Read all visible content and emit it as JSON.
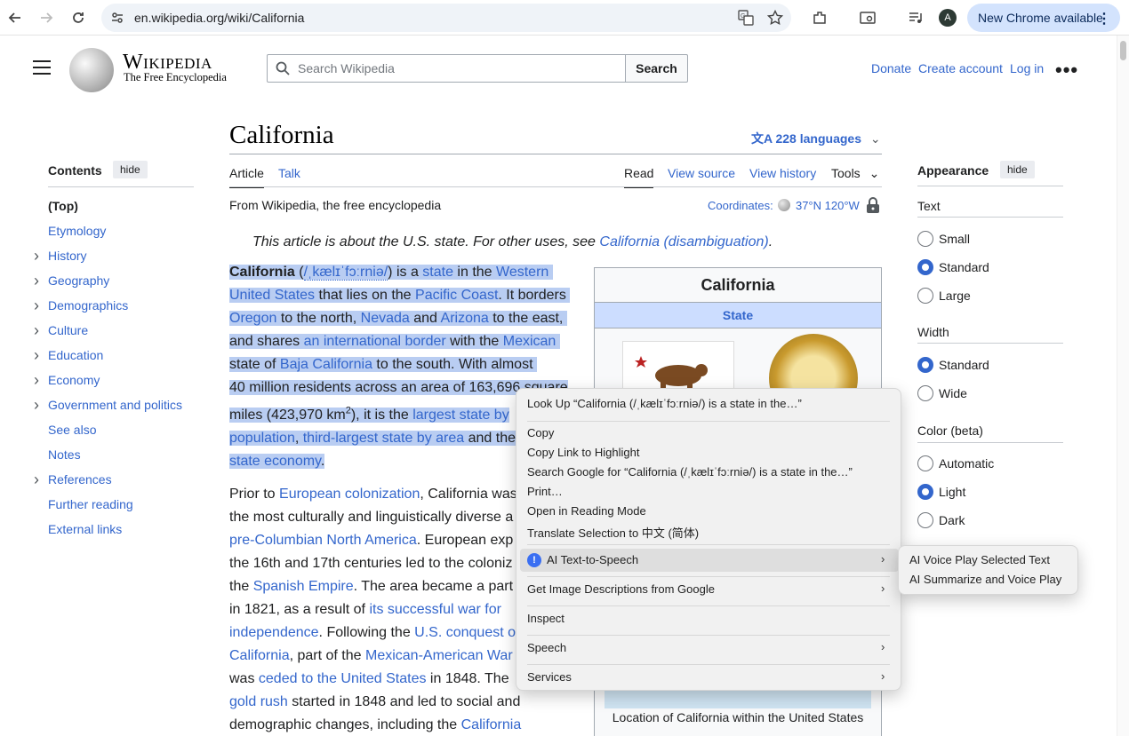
{
  "browser": {
    "url": "en.wikipedia.org/wiki/California",
    "update_label": "New Chrome available",
    "profile_initial": "A"
  },
  "header": {
    "wordmark": "Wikipedia",
    "tagline": "The Free Encyclopedia",
    "search_placeholder": "Search Wikipedia",
    "search_button": "Search",
    "donate": "Donate",
    "create_account": "Create account",
    "log_in": "Log in"
  },
  "toc": {
    "title": "Contents",
    "hide": "hide",
    "items": [
      {
        "label": "(Top)",
        "expandable": false,
        "active": true
      },
      {
        "label": "Etymology",
        "expandable": false
      },
      {
        "label": "History",
        "expandable": true
      },
      {
        "label": "Geography",
        "expandable": true
      },
      {
        "label": "Demographics",
        "expandable": true
      },
      {
        "label": "Culture",
        "expandable": true
      },
      {
        "label": "Education",
        "expandable": true
      },
      {
        "label": "Economy",
        "expandable": true
      },
      {
        "label": "Government and politics",
        "expandable": true
      },
      {
        "label": "See also",
        "expandable": false
      },
      {
        "label": "Notes",
        "expandable": false
      },
      {
        "label": "References",
        "expandable": true
      },
      {
        "label": "Further reading",
        "expandable": false
      },
      {
        "label": "External links",
        "expandable": false
      }
    ]
  },
  "article": {
    "title": "California",
    "languages": "228 languages",
    "tabs": {
      "article": "Article",
      "talk": "Talk",
      "read": "Read",
      "view_source": "View source",
      "view_history": "View history",
      "tools": "Tools"
    },
    "from": "From Wikipedia, the free encyclopedia",
    "coords_label": "Coordinates:",
    "coords_value": "37°N 120°W",
    "hatnote_text": "This article is about the U.S. state. For other uses, see ",
    "hatnote_link": "California (disambiguation)",
    "p1": {
      "l1": [
        "California",
        " (",
        "/ˌkælɪˈfɔːrniə/",
        ") is a ",
        "state",
        " in the ",
        "Western"
      ],
      "l2": [
        "United States",
        " that lies on the ",
        "Pacific Coast",
        ". It borders"
      ],
      "l3": [
        "Oregon",
        " to the north, ",
        "Nevada",
        " and ",
        "Arizona",
        " to the east,"
      ],
      "l4": [
        "and shares ",
        "an international border",
        " with the ",
        "Mexican"
      ],
      "l5": [
        "state of ",
        "Baja California",
        " to the south. With almost"
      ],
      "l6": [
        "40 million residents across an area of 163,696 square"
      ],
      "l7": [
        "miles (423,970 km",
        "2",
        "), it is the ",
        "largest state by"
      ],
      "l8": [
        "population",
        ", ",
        "third-largest state by area",
        " and the"
      ],
      "l9": [
        "state economy",
        "."
      ]
    },
    "p2": {
      "l1": [
        "Prior to ",
        "European colonization",
        ", California was"
      ],
      "l2": [
        "the most culturally and linguistically diverse a"
      ],
      "l3": [
        "pre-Columbian North America",
        ". European exp"
      ],
      "l4": [
        "the 16th and 17th centuries led to the coloniz"
      ],
      "l5": [
        "the ",
        "Spanish Empire",
        ". The area became a part"
      ],
      "l6": [
        "in 1821, as a result of ",
        "its successful war for"
      ],
      "l7": [
        "independence",
        ". Following the ",
        "U.S. conquest o"
      ],
      "l8": [
        "California",
        ", part of the ",
        "Mexican-American War"
      ],
      "l9": [
        "was ",
        "ceded to the United States",
        " in 1848. The "
      ],
      "l10": [
        "gold rush",
        " started in 1848 and led to social and"
      ],
      "l11": [
        "demographic changes, including the ",
        "California"
      ]
    }
  },
  "infobox": {
    "title": "California",
    "subtitle": "State",
    "map_caption": "Location of California within the United States"
  },
  "appearance": {
    "title": "Appearance",
    "hide": "hide",
    "text_label": "Text",
    "text_options": [
      {
        "label": "Small",
        "selected": false
      },
      {
        "label": "Standard",
        "selected": true
      },
      {
        "label": "Large",
        "selected": false
      }
    ],
    "width_label": "Width",
    "width_options": [
      {
        "label": "Standard",
        "selected": true
      },
      {
        "label": "Wide",
        "selected": false
      }
    ],
    "color_label": "Color (beta)",
    "color_options": [
      {
        "label": "Automatic",
        "selected": false
      },
      {
        "label": "Light",
        "selected": true
      },
      {
        "label": "Dark",
        "selected": false
      }
    ]
  },
  "context_menu": {
    "look_up": "Look Up “California (/ˌkælɪˈfɔːrniə/) is a state in the…”",
    "copy": "Copy",
    "copy_link": "Copy Link to Highlight",
    "search_google": "Search Google for “California (/ˌkælɪˈfɔːrniə/) is a state in the…”",
    "print": "Print…",
    "reading_mode": "Open in Reading Mode",
    "translate": "Translate Selection to 中文 (简体)",
    "ai_tts": "AI Text-to-Speech",
    "image_desc": "Get Image Descriptions from Google",
    "inspect": "Inspect",
    "speech": "Speech",
    "services": "Services"
  },
  "submenu": {
    "play_selected": "AI Voice Play Selected Text",
    "summarize": "AI Summarize and Voice Play"
  }
}
